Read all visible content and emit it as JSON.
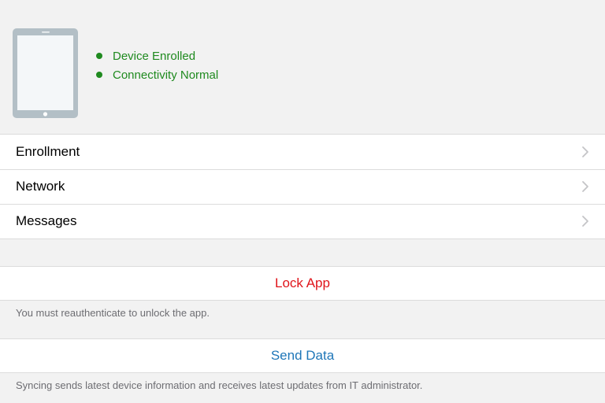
{
  "status": {
    "items": [
      {
        "label": "Device Enrolled"
      },
      {
        "label": "Connectivity Normal"
      }
    ],
    "color": "#1f8a1f"
  },
  "menu": {
    "items": [
      {
        "label": "Enrollment",
        "icon": "chevron-right-icon"
      },
      {
        "label": "Network",
        "icon": "chevron-right-icon"
      },
      {
        "label": "Messages",
        "icon": "chevron-right-icon"
      }
    ]
  },
  "lock": {
    "label": "Lock App",
    "color": "#e0141a",
    "note": "You must reauthenticate to unlock the app."
  },
  "send": {
    "label": "Send Data",
    "color": "#1e76b8",
    "note": "Syncing sends latest device information and receives latest updates from IT administrator."
  }
}
